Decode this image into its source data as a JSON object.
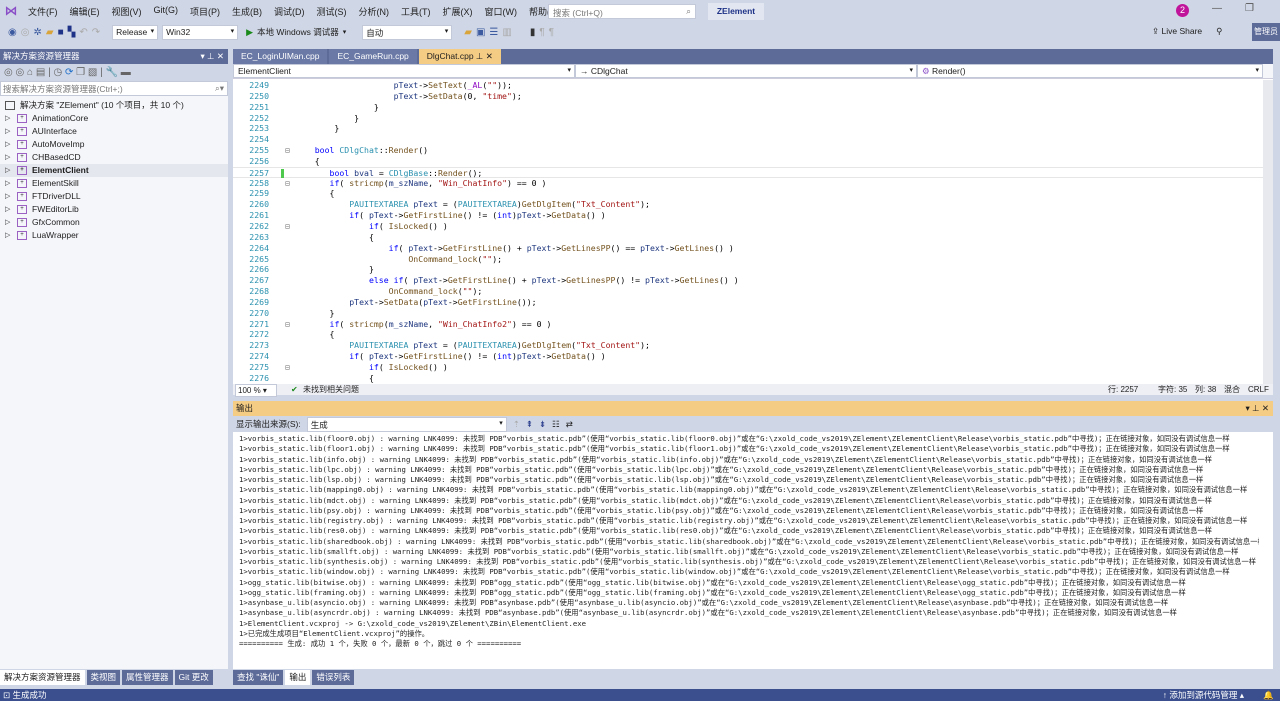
{
  "menubar": {
    "items": [
      "文件(F)",
      "编辑(E)",
      "视图(V)",
      "Git(G)",
      "项目(P)",
      "生成(B)",
      "调试(D)",
      "测试(S)",
      "分析(N)",
      "工具(T)",
      "扩展(X)",
      "窗口(W)",
      "帮助(H)"
    ],
    "search_placeholder": "搜索 (Ctrl+Q)",
    "project": "ZElement",
    "notifications": "2"
  },
  "toolbar": {
    "config": "Release",
    "platform": "Win32",
    "run_label": "本地 Windows 调试器",
    "run_mode": "自动",
    "live_share": "Live Share",
    "admin": "管理员"
  },
  "solution_explorer": {
    "title": "解决方案资源管理器",
    "search_placeholder": "搜索解决方案资源管理器(Ctrl+;)",
    "root": "解决方案 \"ZElement\" (10 个项目，共 10 个)",
    "projects": [
      "AnimationCore",
      "AUInterface",
      "AutoMoveImp",
      "CHBasedCD",
      "ElementClient",
      "ElementSkill",
      "FTDriverDLL",
      "FWEditorLib",
      "GfxCommon",
      "LuaWrapper"
    ],
    "selected": "ElementClient"
  },
  "editor": {
    "tabs": [
      "EC_LoginUIMan.cpp",
      "EC_GameRun.cpp",
      "DlgChat.cpp"
    ],
    "active_tab": "DlgChat.cpp",
    "nav_project": "ElementClient",
    "nav_class": "CDlgChat",
    "nav_member": "Render()",
    "lines": [
      {
        "n": "2249",
        "t": [
          [
            "pl",
            "                    "
          ],
          [
            "vr",
            "pText"
          ],
          [
            "pl",
            "->"
          ],
          [
            "fn",
            "SetText"
          ],
          [
            "pl",
            "("
          ],
          [
            "mc",
            "_AL"
          ],
          [
            "pl",
            "("
          ],
          [
            "st",
            "\"\""
          ],
          [
            "pl",
            "));"
          ]
        ]
      },
      {
        "n": "2250",
        "t": [
          [
            "pl",
            "                    "
          ],
          [
            "vr",
            "pText"
          ],
          [
            "pl",
            "->"
          ],
          [
            "fn",
            "SetData"
          ],
          [
            "pl",
            "(0, "
          ],
          [
            "st",
            "\"time\""
          ],
          [
            "pl",
            ");"
          ]
        ]
      },
      {
        "n": "2251",
        "t": [
          [
            "pl",
            "                }"
          ]
        ]
      },
      {
        "n": "2252",
        "t": [
          [
            "pl",
            "            }"
          ]
        ]
      },
      {
        "n": "2253",
        "t": [
          [
            "pl",
            "        }"
          ]
        ]
      },
      {
        "n": "2254",
        "t": [
          [
            "pl",
            ""
          ]
        ]
      },
      {
        "n": "2255",
        "t": [
          [
            "pl",
            "    "
          ],
          [
            "kw",
            "bool"
          ],
          [
            "pl",
            " "
          ],
          [
            "ty",
            "CDlgChat"
          ],
          [
            "pl",
            "::"
          ],
          [
            "fn",
            "Render"
          ],
          [
            "pl",
            "()"
          ]
        ]
      },
      {
        "n": "2256",
        "t": [
          [
            "pl",
            "    {"
          ]
        ]
      },
      {
        "n": "2257",
        "t": [
          [
            "pl",
            "       "
          ],
          [
            "kw",
            "bool"
          ],
          [
            "pl",
            " "
          ],
          [
            "vr",
            "bval"
          ],
          [
            "pl",
            " = "
          ],
          [
            "ty",
            "CDlgBase"
          ],
          [
            "pl",
            "::"
          ],
          [
            "fn",
            "Render"
          ],
          [
            "pl",
            "();"
          ]
        ]
      },
      {
        "n": "2258",
        "t": [
          [
            "pl",
            "       "
          ],
          [
            "kw",
            "if"
          ],
          [
            "pl",
            "( "
          ],
          [
            "fn",
            "stricmp"
          ],
          [
            "pl",
            "("
          ],
          [
            "vr",
            "m_szName"
          ],
          [
            "pl",
            ", "
          ],
          [
            "st",
            "\"Win_ChatInfo\""
          ],
          [
            "pl",
            ") == 0 )"
          ]
        ]
      },
      {
        "n": "2259",
        "t": [
          [
            "pl",
            "       {"
          ]
        ]
      },
      {
        "n": "2260",
        "t": [
          [
            "pl",
            "           "
          ],
          [
            "ty",
            "PAUITEXTAREA"
          ],
          [
            "pl",
            " "
          ],
          [
            "vr",
            "pText"
          ],
          [
            "pl",
            " = ("
          ],
          [
            "ty",
            "PAUITEXTAREA"
          ],
          [
            "pl",
            ")"
          ],
          [
            "fn",
            "GetDlgItem"
          ],
          [
            "pl",
            "("
          ],
          [
            "st",
            "\"Txt_Content\""
          ],
          [
            "pl",
            ");"
          ]
        ]
      },
      {
        "n": "2261",
        "t": [
          [
            "pl",
            "           "
          ],
          [
            "kw",
            "if"
          ],
          [
            "pl",
            "( "
          ],
          [
            "vr",
            "pText"
          ],
          [
            "pl",
            "->"
          ],
          [
            "fn",
            "GetFirstLine"
          ],
          [
            "pl",
            "() != ("
          ],
          [
            "kw",
            "int"
          ],
          [
            "pl",
            ")"
          ],
          [
            "vr",
            "pText"
          ],
          [
            "pl",
            "->"
          ],
          [
            "fn",
            "GetData"
          ],
          [
            "pl",
            "() )"
          ]
        ]
      },
      {
        "n": "2262",
        "t": [
          [
            "pl",
            "               "
          ],
          [
            "kw",
            "if"
          ],
          [
            "pl",
            "( "
          ],
          [
            "fn",
            "IsLocked"
          ],
          [
            "pl",
            "() )"
          ]
        ]
      },
      {
        "n": "2263",
        "t": [
          [
            "pl",
            "               {"
          ]
        ]
      },
      {
        "n": "2264",
        "t": [
          [
            "pl",
            "                   "
          ],
          [
            "kw",
            "if"
          ],
          [
            "pl",
            "( "
          ],
          [
            "vr",
            "pText"
          ],
          [
            "pl",
            "->"
          ],
          [
            "fn",
            "GetFirstLine"
          ],
          [
            "pl",
            "() + "
          ],
          [
            "vr",
            "pText"
          ],
          [
            "pl",
            "->"
          ],
          [
            "fn",
            "GetLinesPP"
          ],
          [
            "pl",
            "() == "
          ],
          [
            "vr",
            "pText"
          ],
          [
            "pl",
            "->"
          ],
          [
            "fn",
            "GetLines"
          ],
          [
            "pl",
            "() )"
          ]
        ]
      },
      {
        "n": "2265",
        "t": [
          [
            "pl",
            "                       "
          ],
          [
            "fn",
            "OnCommand_lock"
          ],
          [
            "pl",
            "("
          ],
          [
            "st",
            "\"\""
          ],
          [
            "pl",
            ");"
          ]
        ]
      },
      {
        "n": "2266",
        "t": [
          [
            "pl",
            "               }"
          ]
        ]
      },
      {
        "n": "2267",
        "t": [
          [
            "pl",
            "               "
          ],
          [
            "kw",
            "else if"
          ],
          [
            "pl",
            "( "
          ],
          [
            "vr",
            "pText"
          ],
          [
            "pl",
            "->"
          ],
          [
            "fn",
            "GetFirstLine"
          ],
          [
            "pl",
            "() + "
          ],
          [
            "vr",
            "pText"
          ],
          [
            "pl",
            "->"
          ],
          [
            "fn",
            "GetLinesPP"
          ],
          [
            "pl",
            "() != "
          ],
          [
            "vr",
            "pText"
          ],
          [
            "pl",
            "->"
          ],
          [
            "fn",
            "GetLines"
          ],
          [
            "pl",
            "() )"
          ]
        ]
      },
      {
        "n": "2268",
        "t": [
          [
            "pl",
            "                   "
          ],
          [
            "fn",
            "OnCommand_lock"
          ],
          [
            "pl",
            "("
          ],
          [
            "st",
            "\"\""
          ],
          [
            "pl",
            ");"
          ]
        ]
      },
      {
        "n": "2269",
        "t": [
          [
            "pl",
            "           "
          ],
          [
            "vr",
            "pText"
          ],
          [
            "pl",
            "->"
          ],
          [
            "fn",
            "SetData"
          ],
          [
            "pl",
            "("
          ],
          [
            "vr",
            "pText"
          ],
          [
            "pl",
            "->"
          ],
          [
            "fn",
            "GetFirstLine"
          ],
          [
            "pl",
            "());"
          ]
        ]
      },
      {
        "n": "2270",
        "t": [
          [
            "pl",
            "       }"
          ]
        ]
      },
      {
        "n": "2271",
        "t": [
          [
            "pl",
            "       "
          ],
          [
            "kw",
            "if"
          ],
          [
            "pl",
            "( "
          ],
          [
            "fn",
            "stricmp"
          ],
          [
            "pl",
            "("
          ],
          [
            "vr",
            "m_szName"
          ],
          [
            "pl",
            ", "
          ],
          [
            "st",
            "\"Win_ChatInfo2\""
          ],
          [
            "pl",
            ") == 0 )"
          ]
        ]
      },
      {
        "n": "2272",
        "t": [
          [
            "pl",
            "       {"
          ]
        ]
      },
      {
        "n": "2273",
        "t": [
          [
            "pl",
            "           "
          ],
          [
            "ty",
            "PAUITEXTAREA"
          ],
          [
            "pl",
            " "
          ],
          [
            "vr",
            "pText"
          ],
          [
            "pl",
            " = ("
          ],
          [
            "ty",
            "PAUITEXTAREA"
          ],
          [
            "pl",
            ")"
          ],
          [
            "fn",
            "GetDlgItem"
          ],
          [
            "pl",
            "("
          ],
          [
            "st",
            "\"Txt_Content\""
          ],
          [
            "pl",
            ");"
          ]
        ]
      },
      {
        "n": "2274",
        "t": [
          [
            "pl",
            "           "
          ],
          [
            "kw",
            "if"
          ],
          [
            "pl",
            "( "
          ],
          [
            "vr",
            "pText"
          ],
          [
            "pl",
            "->"
          ],
          [
            "fn",
            "GetFirstLine"
          ],
          [
            "pl",
            "() != ("
          ],
          [
            "kw",
            "int"
          ],
          [
            "pl",
            ")"
          ],
          [
            "vr",
            "pText"
          ],
          [
            "pl",
            "->"
          ],
          [
            "fn",
            "GetData"
          ],
          [
            "pl",
            "() )"
          ]
        ]
      },
      {
        "n": "2275",
        "t": [
          [
            "pl",
            "               "
          ],
          [
            "kw",
            "if"
          ],
          [
            "pl",
            "( "
          ],
          [
            "fn",
            "IsLocked"
          ],
          [
            "pl",
            "() )"
          ]
        ]
      },
      {
        "n": "2276",
        "t": [
          [
            "pl",
            "               {"
          ]
        ]
      }
    ],
    "status": {
      "zoom": "100 %",
      "issues": "未找到相关问题",
      "line": "行: 2257",
      "char": "字符: 35",
      "col": "列: 38",
      "mode": "混合",
      "eol": "CRLF"
    }
  },
  "output": {
    "title": "输出",
    "source_label": "显示输出来源(S):",
    "source": "生成",
    "lines": [
      "1>vorbis_static.lib(floor0.obj) : warning LNK4099: 未找到 PDB“vorbis_static.pdb”(使用“vorbis_static.lib(floor0.obj)”或在“G:\\zxold_code_vs2019\\ZElement\\ZElementClient\\Release\\vorbis_static.pdb”中寻找)；正在链接对象，如同没有调试信息一样",
      "1>vorbis_static.lib(floor1.obj) : warning LNK4099: 未找到 PDB“vorbis_static.pdb”(使用“vorbis_static.lib(floor1.obj)”或在“G:\\zxold_code_vs2019\\ZElement\\ZElementClient\\Release\\vorbis_static.pdb”中寻找)；正在链接对象，如同没有调试信息一样",
      "1>vorbis_static.lib(info.obj) : warning LNK4099: 未找到 PDB“vorbis_static.pdb”(使用“vorbis_static.lib(info.obj)”或在“G:\\zxold_code_vs2019\\ZElement\\ZElementClient\\Release\\vorbis_static.pdb”中寻找)；正在链接对象，如同没有调试信息一样",
      "1>vorbis_static.lib(lpc.obj) : warning LNK4099: 未找到 PDB“vorbis_static.pdb”(使用“vorbis_static.lib(lpc.obj)”或在“G:\\zxold_code_vs2019\\ZElement\\ZElementClient\\Release\\vorbis_static.pdb”中寻找)；正在链接对象，如同没有调试信息一样",
      "1>vorbis_static.lib(lsp.obj) : warning LNK4099: 未找到 PDB“vorbis_static.pdb”(使用“vorbis_static.lib(lsp.obj)”或在“G:\\zxold_code_vs2019\\ZElement\\ZElementClient\\Release\\vorbis_static.pdb”中寻找)；正在链接对象，如同没有调试信息一样",
      "1>vorbis_static.lib(mapping0.obj) : warning LNK4099: 未找到 PDB“vorbis_static.pdb”(使用“vorbis_static.lib(mapping0.obj)”或在“G:\\zxold_code_vs2019\\ZElement\\ZElementClient\\Release\\vorbis_static.pdb”中寻找)；正在链接对象，如同没有调试信息一样",
      "1>vorbis_static.lib(mdct.obj) : warning LNK4099: 未找到 PDB“vorbis_static.pdb”(使用“vorbis_static.lib(mdct.obj)”或在“G:\\zxold_code_vs2019\\ZElement\\ZElementClient\\Release\\vorbis_static.pdb”中寻找)；正在链接对象，如同没有调试信息一样",
      "1>vorbis_static.lib(psy.obj) : warning LNK4099: 未找到 PDB“vorbis_static.pdb”(使用“vorbis_static.lib(psy.obj)”或在“G:\\zxold_code_vs2019\\ZElement\\ZElementClient\\Release\\vorbis_static.pdb”中寻找)；正在链接对象，如同没有调试信息一样",
      "1>vorbis_static.lib(registry.obj) : warning LNK4099: 未找到 PDB“vorbis_static.pdb”(使用“vorbis_static.lib(registry.obj)”或在“G:\\zxold_code_vs2019\\ZElement\\ZElementClient\\Release\\vorbis_static.pdb”中寻找)；正在链接对象，如同没有调试信息一样",
      "1>vorbis_static.lib(res0.obj) : warning LNK4099: 未找到 PDB“vorbis_static.pdb”(使用“vorbis_static.lib(res0.obj)”或在“G:\\zxold_code_vs2019\\ZElement\\ZElementClient\\Release\\vorbis_static.pdb”中寻找)；正在链接对象，如同没有调试信息一样",
      "1>vorbis_static.lib(sharedbook.obj) : warning LNK4099: 未找到 PDB“vorbis_static.pdb”(使用“vorbis_static.lib(sharedbook.obj)”或在“G:\\zxold_code_vs2019\\ZElement\\ZElementClient\\Release\\vorbis_static.pdb”中寻找)；正在链接对象，如同没有调试信息一样",
      "1>vorbis_static.lib(smallft.obj) : warning LNK4099: 未找到 PDB“vorbis_static.pdb”(使用“vorbis_static.lib(smallft.obj)”或在“G:\\zxold_code_vs2019\\ZElement\\ZElementClient\\Release\\vorbis_static.pdb”中寻找)；正在链接对象，如同没有调试信息一样",
      "1>vorbis_static.lib(synthesis.obj) : warning LNK4099: 未找到 PDB“vorbis_static.pdb”(使用“vorbis_static.lib(synthesis.obj)”或在“G:\\zxold_code_vs2019\\ZElement\\ZElementClient\\Release\\vorbis_static.pdb”中寻找)；正在链接对象，如同没有调试信息一样",
      "1>vorbis_static.lib(window.obj) : warning LNK4099: 未找到 PDB“vorbis_static.pdb”(使用“vorbis_static.lib(window.obj)”或在“G:\\zxold_code_vs2019\\ZElement\\ZElementClient\\Release\\vorbis_static.pdb”中寻找)；正在链接对象，如同没有调试信息一样",
      "1>ogg_static.lib(bitwise.obj) : warning LNK4099: 未找到 PDB“ogg_static.pdb”(使用“ogg_static.lib(bitwise.obj)”或在“G:\\zxold_code_vs2019\\ZElement\\ZElementClient\\Release\\ogg_static.pdb”中寻找)；正在链接对象，如同没有调试信息一样",
      "1>ogg_static.lib(framing.obj) : warning LNK4099: 未找到 PDB“ogg_static.pdb”(使用“ogg_static.lib(framing.obj)”或在“G:\\zxold_code_vs2019\\ZElement\\ZElementClient\\Release\\ogg_static.pdb”中寻找)；正在链接对象，如同没有调试信息一样",
      "1>asynbase_u.lib(asyncio.obj) : warning LNK4099: 未找到 PDB“asynbase.pdb”(使用“asynbase_u.lib(asyncio.obj)”或在“G:\\zxold_code_vs2019\\ZElement\\ZElementClient\\Release\\asynbase.pdb”中寻找)；正在链接对象，如同没有调试信息一样",
      "1>asynbase_u.lib(asyncrdr.obj) : warning LNK4099: 未找到 PDB“asynbase.pdb”(使用“asynbase_u.lib(asyncrdr.obj)”或在“G:\\zxold_code_vs2019\\ZElement\\ZElementClient\\Release\\asynbase.pdb”中寻找)；正在链接对象，如同没有调试信息一样",
      "1>ElementClient.vcxproj -> G:\\zxold_code_vs2019\\ZElement\\ZBin\\ElementClient.exe",
      "1>已完成生成项目“ElementClient.vcxproj”的操作。",
      "========== 生成: 成功 1 个，失败 0 个，最新 0 个，跳过 0 个 =========="
    ]
  },
  "bottom_tabs_left": [
    "解决方案资源管理器",
    "类视图",
    "属性管理器",
    "Git 更改"
  ],
  "bottom_tabs_right": [
    "查找 \"诛仙\"",
    "输出",
    "错误列表"
  ],
  "statusbar": {
    "message": "生成成功",
    "source_control": "添加到源代码管理"
  }
}
